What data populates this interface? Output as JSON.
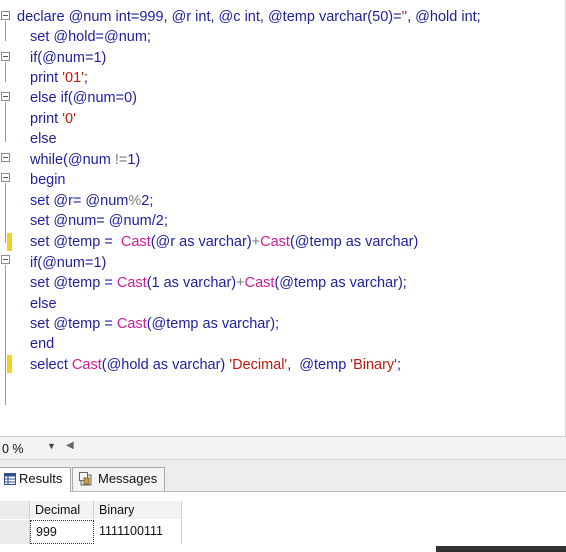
{
  "editor": {
    "lines": [
      [
        {
          "t": "declare @num ",
          "c": "kw"
        },
        {
          "t": "int",
          "c": "kw"
        },
        {
          "t": "=999, @r ",
          "c": "kw"
        },
        {
          "t": "int",
          "c": "kw"
        },
        {
          "t": ", @c ",
          "c": "kw"
        },
        {
          "t": "int",
          "c": "kw"
        },
        {
          "t": ", @temp ",
          "c": "kw"
        },
        {
          "t": "varchar",
          "c": "kw"
        },
        {
          "t": "(50)=",
          "c": "kw"
        },
        {
          "t": "''",
          "c": "str"
        },
        {
          "t": ", @hold ",
          "c": "kw"
        },
        {
          "t": "int",
          "c": "kw"
        },
        {
          "t": ";",
          "c": "kw"
        }
      ],
      [
        {
          "t": "set @hold=@num;",
          "c": "kw"
        }
      ],
      [
        {
          "t": "if(@num=1)",
          "c": "kw"
        }
      ],
      [
        {
          "t": "print ",
          "c": "kw"
        },
        {
          "t": "'01'",
          "c": "str"
        },
        {
          "t": ";",
          "c": "kw"
        }
      ],
      [
        {
          "t": "else if(@num=0)",
          "c": "kw"
        }
      ],
      [
        {
          "t": "print ",
          "c": "kw"
        },
        {
          "t": "'0'",
          "c": "str"
        }
      ],
      [
        {
          "t": "else",
          "c": "kw"
        }
      ],
      [
        {
          "t": "while(@num ",
          "c": "kw"
        },
        {
          "t": "!=",
          "c": "op"
        },
        {
          "t": "1)",
          "c": "kw"
        }
      ],
      [
        {
          "t": "begin",
          "c": "kw"
        }
      ],
      [
        {
          "t": "set @r= @num",
          "c": "kw"
        },
        {
          "t": "%",
          "c": "op"
        },
        {
          "t": "2;",
          "c": "kw"
        }
      ],
      [
        {
          "t": "set @num= @num/2;",
          "c": "kw"
        }
      ],
      [
        {
          "t": "set @temp =  ",
          "c": "kw"
        },
        {
          "t": "Cast",
          "c": "fn"
        },
        {
          "t": "(@r as varchar)",
          "c": "kw"
        },
        {
          "t": "+",
          "c": "op"
        },
        {
          "t": "Cast",
          "c": "fn"
        },
        {
          "t": "(@temp as varchar)",
          "c": "kw"
        }
      ],
      [
        {
          "t": "if(@num=1)",
          "c": "kw"
        }
      ],
      [
        {
          "t": "set @temp = ",
          "c": "kw"
        },
        {
          "t": "Cast",
          "c": "fn"
        },
        {
          "t": "(1 as varchar)",
          "c": "kw"
        },
        {
          "t": "+",
          "c": "op"
        },
        {
          "t": "Cast",
          "c": "fn"
        },
        {
          "t": "(@temp as varchar);",
          "c": "kw"
        }
      ],
      [
        {
          "t": "else",
          "c": "kw"
        }
      ],
      [
        {
          "t": "set @temp = ",
          "c": "kw"
        },
        {
          "t": "Cast",
          "c": "fn"
        },
        {
          "t": "(@temp as varchar);",
          "c": "kw"
        }
      ],
      [
        {
          "t": "end",
          "c": "kw"
        }
      ],
      [
        {
          "t": "select ",
          "c": "kw"
        },
        {
          "t": "Cast",
          "c": "fn"
        },
        {
          "t": "(@hold as varchar) ",
          "c": "kw"
        },
        {
          "t": "'Decimal'",
          "c": "str"
        },
        {
          "t": ",  @temp ",
          "c": "kw"
        },
        {
          "t": "'Binary'",
          "c": "str"
        },
        {
          "t": ";",
          "c": "kw"
        }
      ]
    ],
    "colors": {
      "keyword": "#1f1f9e",
      "function": "#d11b9a",
      "string": "#c0180f",
      "operator": "#7a7a7a",
      "change_marker": "#f2d21b"
    }
  },
  "zoom": {
    "value": "0 %",
    "dropdown_icon": "caret-down-icon",
    "scroll_icon": "scroll-left-icon"
  },
  "tabs": [
    {
      "label": "Results",
      "icon": "grid-icon",
      "active": true
    },
    {
      "label": "Messages",
      "icon": "messages-icon",
      "active": false
    }
  ],
  "results": {
    "columns": [
      "Decimal",
      "Binary"
    ],
    "rows": [
      [
        "999",
        "1111100111"
      ]
    ]
  }
}
